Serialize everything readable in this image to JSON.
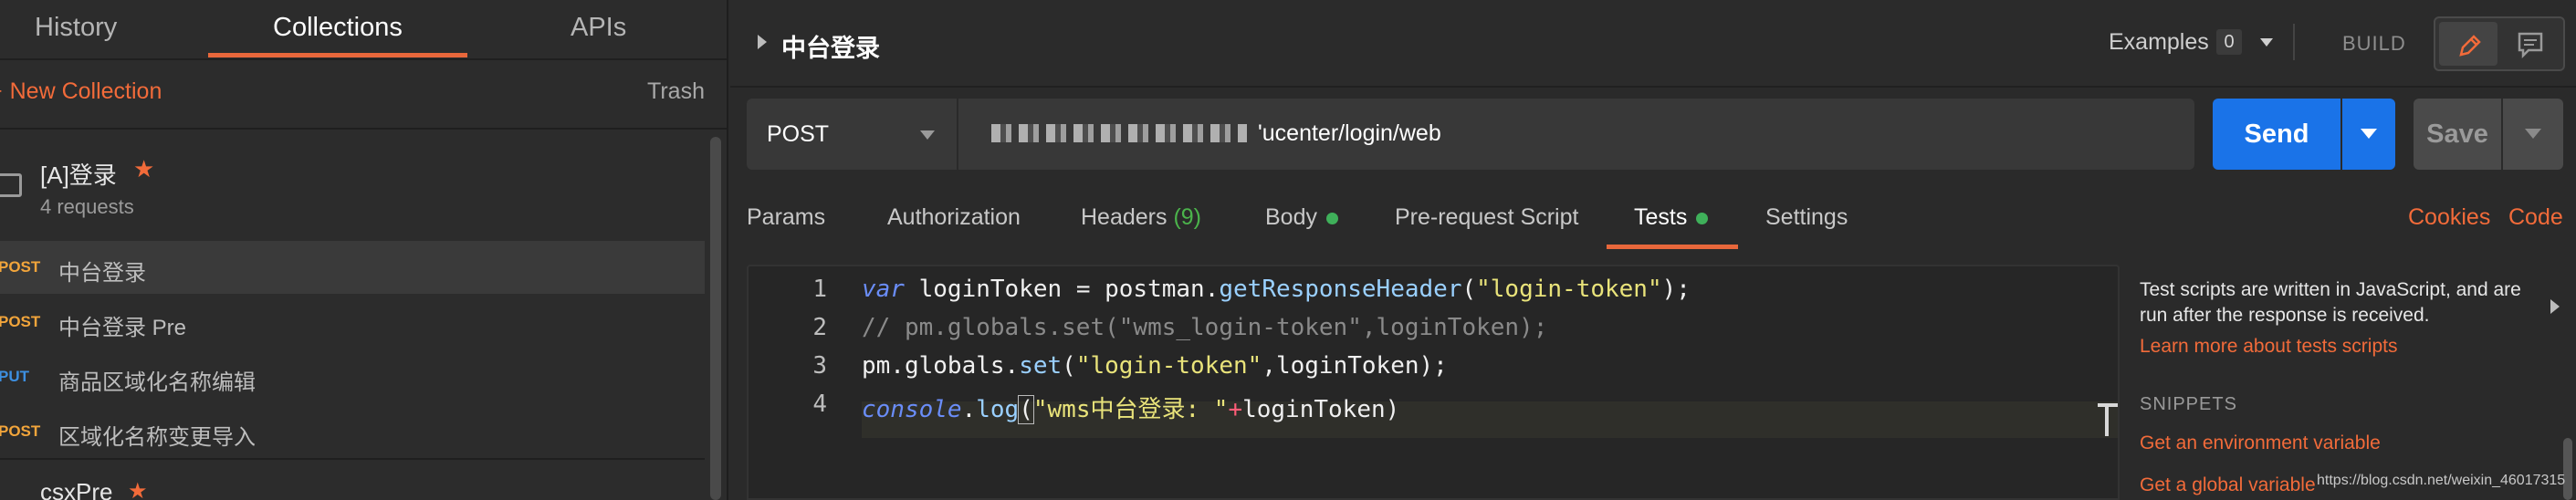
{
  "sidebar": {
    "tabs": [
      {
        "label": "History"
      },
      {
        "label": "Collections"
      },
      {
        "label": "APIs"
      }
    ],
    "new_collection": "New Collection",
    "trash": "Trash",
    "folder": {
      "name": "[A]登录",
      "count": "4 requests"
    },
    "requests": [
      {
        "method": "POST",
        "name": "中台登录"
      },
      {
        "method": "POST",
        "name": "中台登录 Pre"
      },
      {
        "method": "PUT",
        "name": "商品区域化名称编辑"
      },
      {
        "method": "POST",
        "name": "区域化名称变更导入"
      }
    ],
    "folder2": {
      "name": "csxPre"
    }
  },
  "header": {
    "title": "中台登录",
    "examples_label": "Examples",
    "examples_count": "0",
    "build": "BUILD"
  },
  "request": {
    "method": "POST",
    "url": "'ucenter/login/web",
    "send": "Send",
    "save": "Save"
  },
  "tabs": {
    "params": "Params",
    "authorization": "Authorization",
    "headers": "Headers",
    "headers_count": "(9)",
    "body": "Body",
    "prerequest": "Pre-request Script",
    "tests": "Tests",
    "settings": "Settings",
    "cookies": "Cookies",
    "code": "Code"
  },
  "editor": {
    "line_numbers": [
      "1",
      "2",
      "3",
      "4"
    ],
    "l1": {
      "kw": "var",
      "a": " loginToken ",
      "op": "=",
      "b": " postman.",
      "fn": "getResponseHeader",
      "c": "(",
      "str": "\"login-token\"",
      "d": ");"
    },
    "l2": {
      "cmt": "// pm.globals.set(\"wms_login-token\",loginToken);"
    },
    "l3": {
      "a": "pm.globals.",
      "fn": "set",
      "b": "(",
      "str": "\"login-token\"",
      "c": ",loginToken);"
    },
    "l4": {
      "kw": "console",
      "a": ".",
      "fn": "log",
      "b": "(",
      "str": "\"wms中台登录: \"",
      "op": "+",
      "c": "loginToken)"
    }
  },
  "snippets": {
    "info": "Test scripts are written in JavaScript, and are run after the response is received.",
    "learn_more": "Learn more about tests scripts",
    "heading": "SNIPPETS",
    "items": [
      "Get an environment variable",
      "Get a global variable"
    ]
  },
  "watermark": "https://blog.csdn.net/weixin_46017315"
}
